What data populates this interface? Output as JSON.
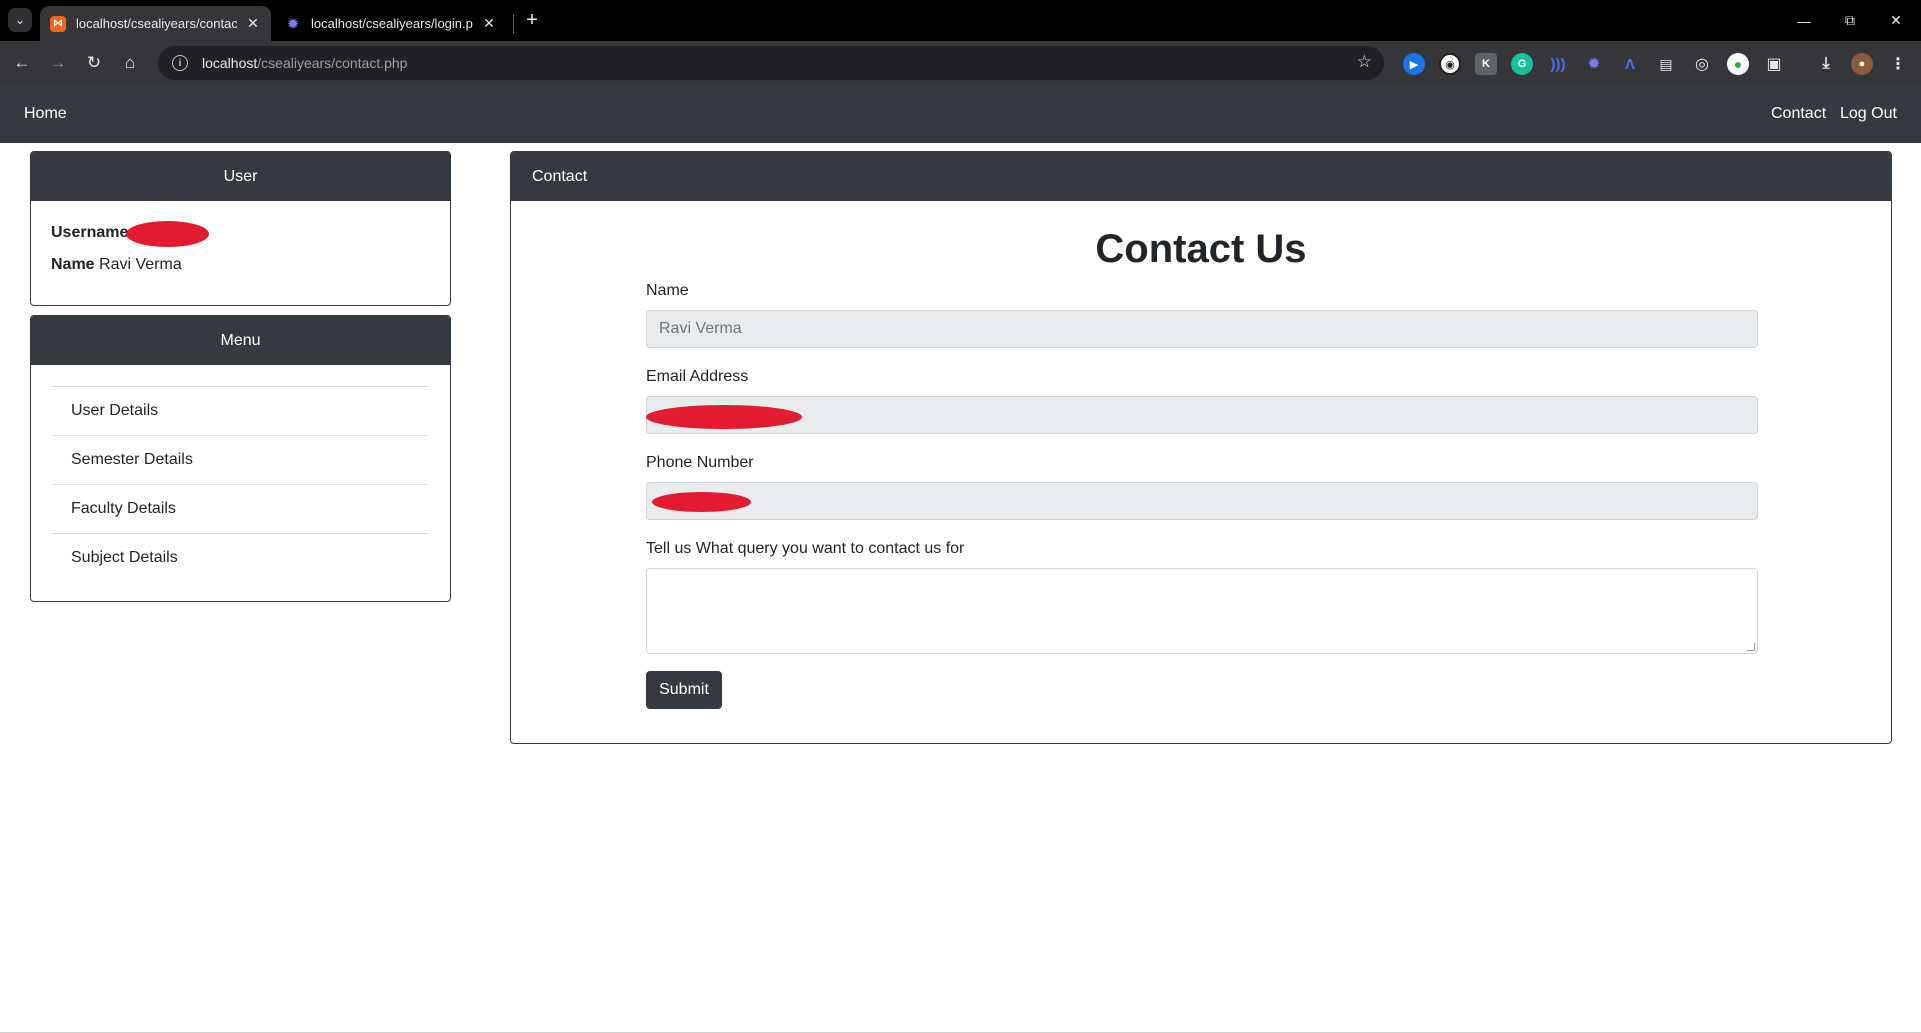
{
  "browser": {
    "tabs": [
      {
        "title": "localhost/csealiyears/contact.pl",
        "favicon": "xampp-icon",
        "active": true
      },
      {
        "title": "localhost/csealiyears/login.php",
        "favicon": "gear-icon",
        "active": false
      }
    ],
    "url_host": "localhost",
    "url_path": "/csealiyears/contact.php"
  },
  "nav": {
    "home": "Home",
    "contact": "Contact",
    "logout": "Log Out"
  },
  "user_card": {
    "header": "User",
    "username_label": "Username",
    "name_label": "Name",
    "name_value": "Ravi Verma"
  },
  "menu_card": {
    "header": "Menu",
    "items": [
      {
        "label": "User Details"
      },
      {
        "label": "Semester Details"
      },
      {
        "label": "Faculty Details"
      },
      {
        "label": "Subject Details"
      }
    ]
  },
  "contact": {
    "header": "Contact",
    "title": "Contact Us",
    "name_label": "Name",
    "name_value": "Ravi Verma",
    "email_label": "Email Address",
    "phone_label": "Phone Number",
    "query_label": "Tell us What query you want to contact us for",
    "submit_label": "Submit"
  },
  "colors": {
    "navbar": "#343a40",
    "redaction": "#e31b2f",
    "input_disabled": "#e9ecef"
  }
}
